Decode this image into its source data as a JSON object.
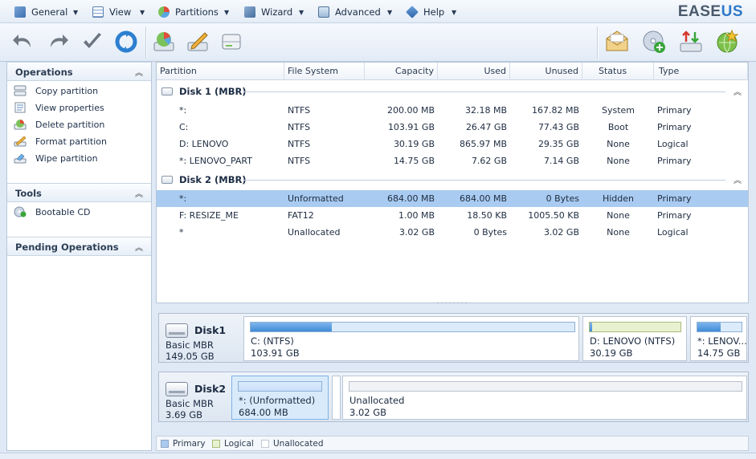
{
  "menu": {
    "items": [
      {
        "label": "General",
        "icon": "general-icon"
      },
      {
        "label": "View",
        "icon": "view-icon"
      },
      {
        "label": "Partitions",
        "icon": "partitions-icon"
      },
      {
        "label": "Wizard",
        "icon": "wizard-icon"
      },
      {
        "label": "Advanced",
        "icon": "advanced-icon"
      },
      {
        "label": "Help",
        "icon": "help-icon"
      }
    ]
  },
  "brand": {
    "part1": "EASE",
    "part2": "US"
  },
  "left_panel": {
    "operations": {
      "title": "Operations",
      "items": [
        {
          "label": "Copy partition",
          "icon": "copy-partition-icon"
        },
        {
          "label": "View properties",
          "icon": "view-properties-icon"
        },
        {
          "label": "Delete partition",
          "icon": "delete-partition-icon"
        },
        {
          "label": "Format partition",
          "icon": "format-partition-icon"
        },
        {
          "label": "Wipe partition",
          "icon": "wipe-partition-icon"
        }
      ]
    },
    "tools": {
      "title": "Tools",
      "items": [
        {
          "label": "Bootable CD",
          "icon": "bootable-cd-icon"
        }
      ]
    },
    "pending": {
      "title": "Pending Operations"
    }
  },
  "table": {
    "columns": [
      "Partition",
      "File System",
      "Capacity",
      "Used",
      "Unused",
      "Status",
      "Type"
    ],
    "disks": [
      {
        "label": "Disk 1 (MBR)",
        "rows": [
          {
            "partition": "*:",
            "fs": "NTFS",
            "capacity": "200.00 MB",
            "used": "32.18 MB",
            "unused": "167.82 MB",
            "status": "System",
            "type": "Primary"
          },
          {
            "partition": "C:",
            "fs": "NTFS",
            "capacity": "103.91 GB",
            "used": "26.47 GB",
            "unused": "77.43 GB",
            "status": "Boot",
            "type": "Primary"
          },
          {
            "partition": "D: LENOVO",
            "fs": "NTFS",
            "capacity": "30.19 GB",
            "used": "865.97 MB",
            "unused": "29.35 GB",
            "status": "None",
            "type": "Logical"
          },
          {
            "partition": "*: LENOVO_PART",
            "fs": "NTFS",
            "capacity": "14.75 GB",
            "used": "7.62 GB",
            "unused": "7.14 GB",
            "status": "None",
            "type": "Primary"
          }
        ]
      },
      {
        "label": "Disk 2 (MBR)",
        "rows": [
          {
            "partition": "*:",
            "fs": "Unformatted",
            "capacity": "684.00 MB",
            "used": "684.00 MB",
            "unused": "0 Bytes",
            "status": "Hidden",
            "type": "Primary"
          },
          {
            "partition": "F: RESIZE_ME",
            "fs": "FAT12",
            "capacity": "1.00 MB",
            "used": "18.50 KB",
            "unused": "1005.50 KB",
            "status": "None",
            "type": "Primary"
          },
          {
            "partition": "*",
            "fs": "Unallocated",
            "capacity": "3.02 GB",
            "used": "0 Bytes",
            "unused": "3.02 GB",
            "status": "None",
            "type": "Logical"
          }
        ]
      }
    ]
  },
  "disk_map": {
    "disk1": {
      "name": "Disk1",
      "kind": "Basic MBR",
      "size": "149.05 GB",
      "parts": [
        {
          "name": "C: (NTFS)",
          "size": "103.91 GB",
          "used_fraction": 0.25
        },
        {
          "name": "D: LENOVO (NTFS)",
          "size": "30.19 GB",
          "used_fraction": 0.03
        },
        {
          "name": "*: LENOV...",
          "size": "14.75 GB",
          "used_fraction": 0.52
        }
      ]
    },
    "disk2": {
      "name": "Disk2",
      "kind": "Basic MBR",
      "size": "3.69 GB",
      "parts": [
        {
          "name": "*: (Unformatted)",
          "size": "684.00 MB",
          "used_fraction": 1.0
        },
        {
          "name": "Unallocated",
          "size": "3.02 GB",
          "used_fraction": 0
        }
      ]
    }
  },
  "legend": {
    "primary": "Primary",
    "logical": "Logical",
    "unallocated": "Unallocated"
  },
  "colors": {
    "selected_row": "#a9cbf1",
    "primary_fill": "#3f8bd8",
    "logical_fill": "#e9f2d0",
    "brand_accent": "#2e78c8"
  }
}
